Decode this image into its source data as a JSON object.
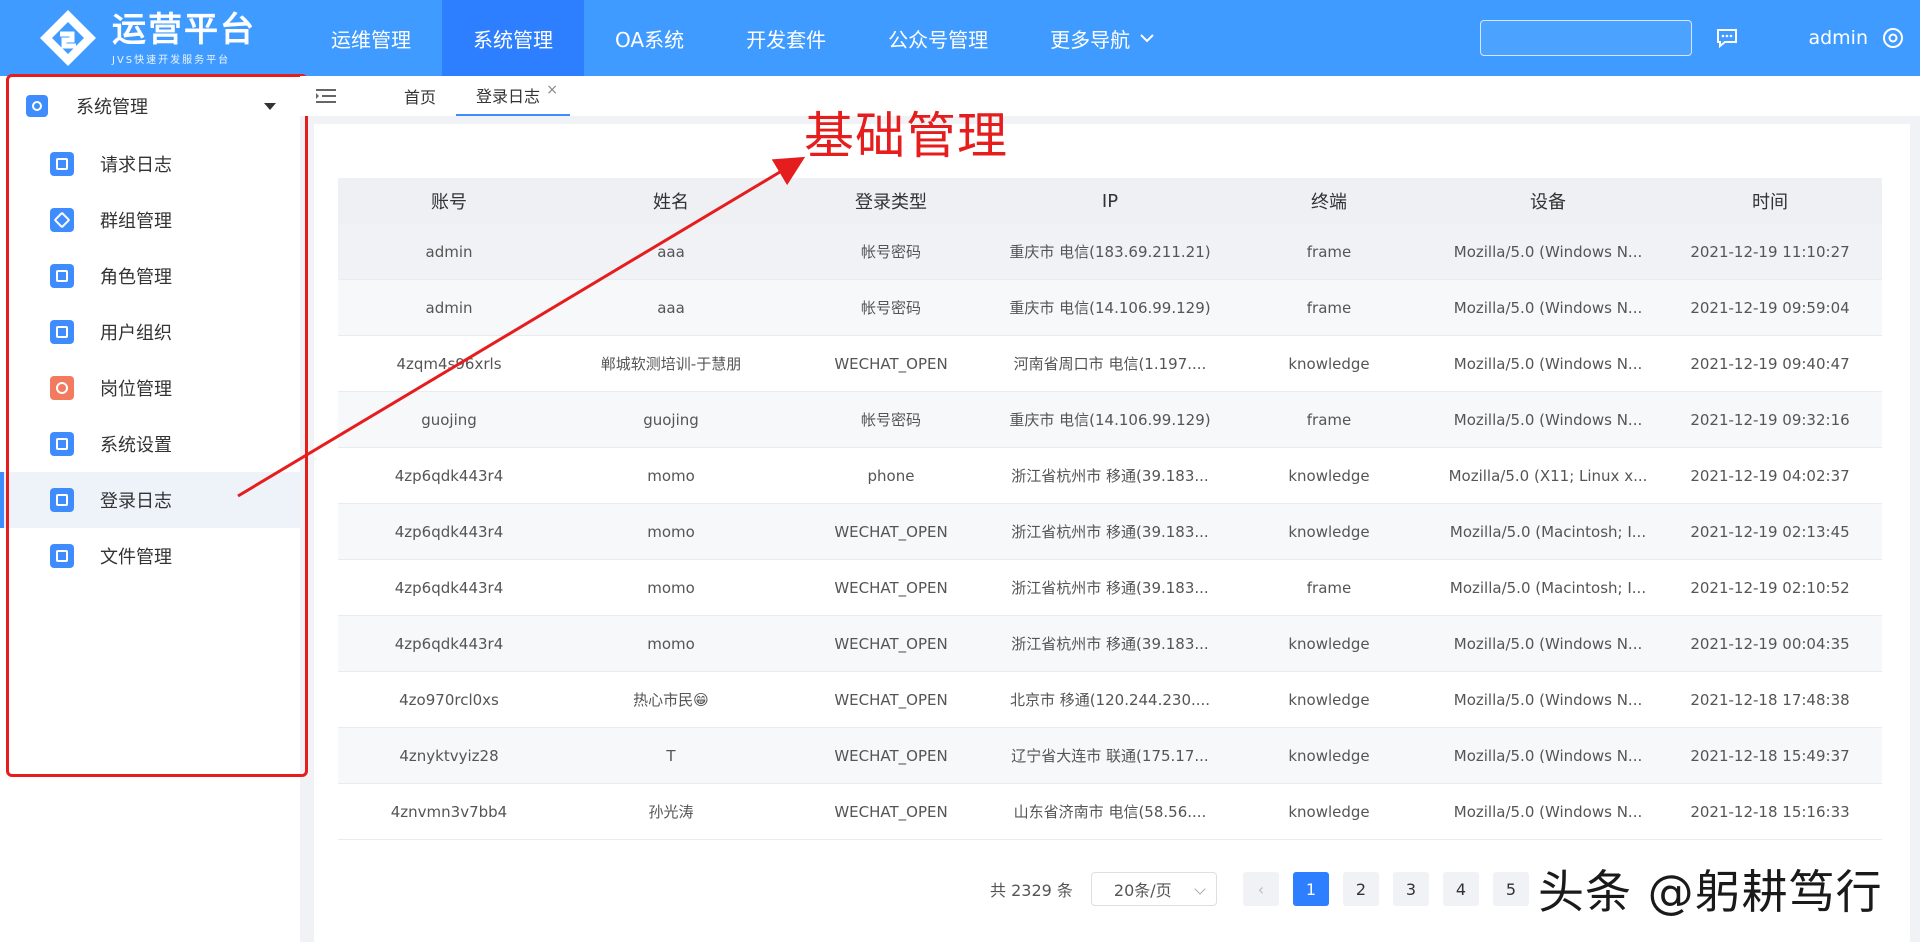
{
  "logo": {
    "title": "运营平台",
    "subtitle": "JVS快速开发服务平台"
  },
  "nav": {
    "items": [
      "运维管理",
      "系统管理",
      "OA系统",
      "开发套件",
      "公众号管理",
      "更多导航"
    ]
  },
  "header": {
    "user": "admin"
  },
  "sidebar": {
    "group": "系统管理",
    "items": [
      {
        "label": "请求日志"
      },
      {
        "label": "群组管理"
      },
      {
        "label": "角色管理"
      },
      {
        "label": "用户组织"
      },
      {
        "label": "岗位管理"
      },
      {
        "label": "系统设置"
      },
      {
        "label": "登录日志"
      },
      {
        "label": "文件管理"
      }
    ]
  },
  "tabs": {
    "home": "首页",
    "current": "登录日志",
    "close": "×"
  },
  "annotation": {
    "label": "基础管理"
  },
  "table": {
    "headers": [
      "账号",
      "姓名",
      "登录类型",
      "IP",
      "终端",
      "设备",
      "时间"
    ],
    "rows": [
      [
        "admin",
        "aaa",
        "帐号密码",
        "重庆市 电信(183.69.211.21)",
        "frame",
        "Mozilla/5.0 (Windows N...",
        "2021-12-19 11:10:27"
      ],
      [
        "admin",
        "aaa",
        "帐号密码",
        "重庆市 电信(14.106.99.129)",
        "frame",
        "Mozilla/5.0 (Windows N...",
        "2021-12-19 09:59:04"
      ],
      [
        "4zqm4s96xrls",
        "郸城软测培训-于慧朋",
        "WECHAT_OPEN",
        "河南省周口市 电信(1.197....",
        "knowledge",
        "Mozilla/5.0 (Windows N...",
        "2021-12-19 09:40:47"
      ],
      [
        "guojing",
        "guojing",
        "帐号密码",
        "重庆市 电信(14.106.99.129)",
        "frame",
        "Mozilla/5.0 (Windows N...",
        "2021-12-19 09:32:16"
      ],
      [
        "4zp6qdk443r4",
        "momo",
        "phone",
        "浙江省杭州市 移通(39.183...",
        "knowledge",
        "Mozilla/5.0 (X11; Linux x...",
        "2021-12-19 04:02:37"
      ],
      [
        "4zp6qdk443r4",
        "momo",
        "WECHAT_OPEN",
        "浙江省杭州市 移通(39.183...",
        "knowledge",
        "Mozilla/5.0 (Macintosh; I...",
        "2021-12-19 02:13:45"
      ],
      [
        "4zp6qdk443r4",
        "momo",
        "WECHAT_OPEN",
        "浙江省杭州市 移通(39.183...",
        "frame",
        "Mozilla/5.0 (Macintosh; I...",
        "2021-12-19 02:10:52"
      ],
      [
        "4zp6qdk443r4",
        "momo",
        "WECHAT_OPEN",
        "浙江省杭州市 移通(39.183...",
        "knowledge",
        "Mozilla/5.0 (Windows N...",
        "2021-12-19 00:04:35"
      ],
      [
        "4zo970rcl0xs",
        "热心市民😁",
        "WECHAT_OPEN",
        "北京市 移通(120.244.230....",
        "knowledge",
        "Mozilla/5.0 (Windows N...",
        "2021-12-18 17:48:38"
      ],
      [
        "4znyktvyiz28",
        "T",
        "WECHAT_OPEN",
        "辽宁省大连市 联通(175.17...",
        "knowledge",
        "Mozilla/5.0 (Windows N...",
        "2021-12-18 15:49:37"
      ],
      [
        "4znvmn3v7bb4",
        "孙光涛",
        "WECHAT_OPEN",
        "山东省济南市 电信(58.56....",
        "knowledge",
        "Mozilla/5.0 (Windows N...",
        "2021-12-18 15:16:33"
      ]
    ]
  },
  "pagination": {
    "total": "共 2329 条",
    "page_size": "20条/页",
    "pages": [
      "1",
      "2",
      "3",
      "4",
      "5"
    ],
    "prev": "‹"
  },
  "watermark": {
    "text": "头条 @躬耕笃行"
  },
  "colors": {
    "topbar": "#3f9bff",
    "active_nav": "#2e7fff",
    "accent": "#3f8cff",
    "annotation": "#e61d1d"
  }
}
